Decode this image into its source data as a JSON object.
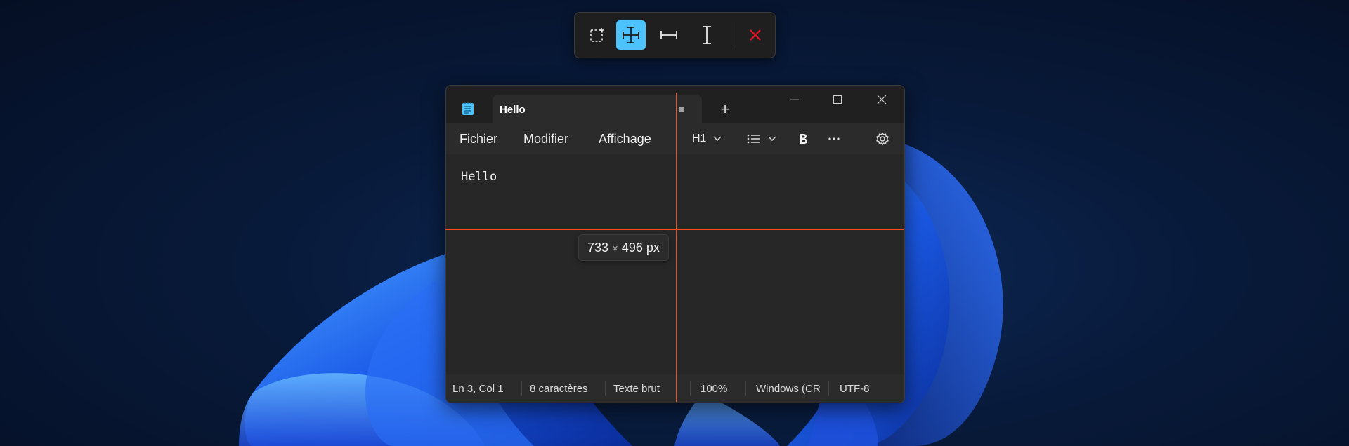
{
  "toolbar": {
    "tools": [
      {
        "name": "bounds",
        "icon": "dashed-select-icon",
        "active": false
      },
      {
        "name": "spacing",
        "icon": "crosshair-icon",
        "active": true
      },
      {
        "name": "horizontal",
        "icon": "horizontal-measure-icon",
        "active": false
      },
      {
        "name": "vertical",
        "icon": "vertical-measure-icon",
        "active": false
      }
    ],
    "close_icon": "close-icon",
    "accent": "#4cc2ff",
    "close_color": "#e81123"
  },
  "window": {
    "tab_title": "Hello",
    "new_tab": "+",
    "menu": [
      "Fichier",
      "Modifier",
      "Affichage"
    ],
    "heading_select": "H1",
    "editor_text": "Hello",
    "status": {
      "position": "Ln 3, Col 1",
      "chars": "8 caractères",
      "format": "Texte brut",
      "zoom": "100%",
      "line_ending": "Windows (CR",
      "encoding": "UTF-8"
    }
  },
  "measure": {
    "width": "733",
    "times": "×",
    "height": "496",
    "unit": "px",
    "guide_color": "#ff4a1c"
  }
}
